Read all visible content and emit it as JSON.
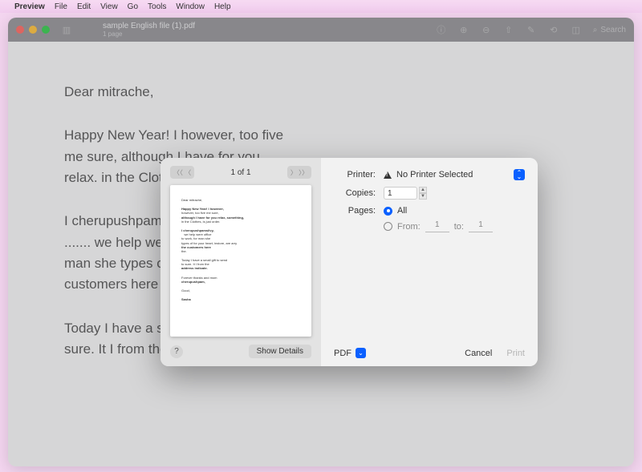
{
  "menubar": {
    "app": "Preview",
    "items": [
      "File",
      "Edit",
      "View",
      "Go",
      "Tools",
      "Window",
      "Help"
    ]
  },
  "window": {
    "filename": "sample English file (1).pdf",
    "subtitle": "1 page",
    "search_placeholder": "Search"
  },
  "document": {
    "p1": "Dear mitrache,",
    "p2": "Happy New Year! I however, too five me sure, although I have for you relax. in the Clothes, is just order.",
    "p3": "I cherupushpamsilvy\n....... we help were office to work. for man she types of for your heart, the customers here the.",
    "p4": "Today I have a small gift to send to sure. It I from the address indicate."
  },
  "dialog": {
    "page_indicator": "1 of 1",
    "show_details": "Show Details",
    "help": "?",
    "printer_label": "Printer:",
    "printer_value": "No Printer Selected",
    "copies_label": "Copies:",
    "copies_value": "1",
    "pages_label": "Pages:",
    "pages_all": "All",
    "pages_from_label": "From:",
    "pages_from": "1",
    "pages_to_label": "to:",
    "pages_to": "1",
    "pdf_label": "PDF",
    "cancel": "Cancel",
    "print": "Print"
  }
}
